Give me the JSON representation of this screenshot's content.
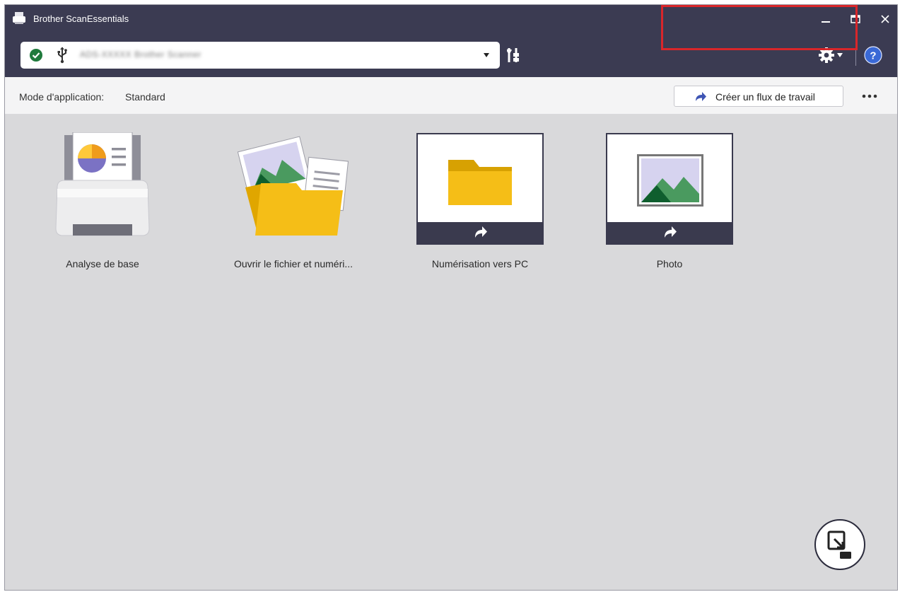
{
  "window": {
    "title": "Brother ScanEssentials",
    "controls": [
      "minimize",
      "maximize",
      "close"
    ]
  },
  "toolbar": {
    "device": {
      "status_icon": "check-circle-icon",
      "connection_icon": "usb-icon",
      "name": "ADS-XXXXX Brother Scanner"
    },
    "icons": [
      "device-settings-icon",
      "gear-icon",
      "help-icon"
    ]
  },
  "modebar": {
    "mode_label": "Mode d'application:",
    "mode_value": "Standard",
    "create_workflow_label": "Créer un flux de travail",
    "more_icon": "more-icon"
  },
  "tiles": [
    {
      "label": "Analyse de base",
      "icon": "scanner-icon"
    },
    {
      "label": "Ouvrir le fichier et numéri...",
      "icon": "open-folder-icon"
    },
    {
      "label": "Numérisation vers PC",
      "icon": "folder-icon"
    },
    {
      "label": "Photo",
      "icon": "photo-icon"
    }
  ],
  "fab": {
    "icon": "scan-to-device-icon"
  },
  "colors": {
    "titlebar": "#3b3b52",
    "background": "#d9d9db",
    "accent_folder": "#f5be17",
    "highlight": "#d9262a",
    "help_blue": "#3a69d6",
    "status_green": "#1f7a3c"
  }
}
